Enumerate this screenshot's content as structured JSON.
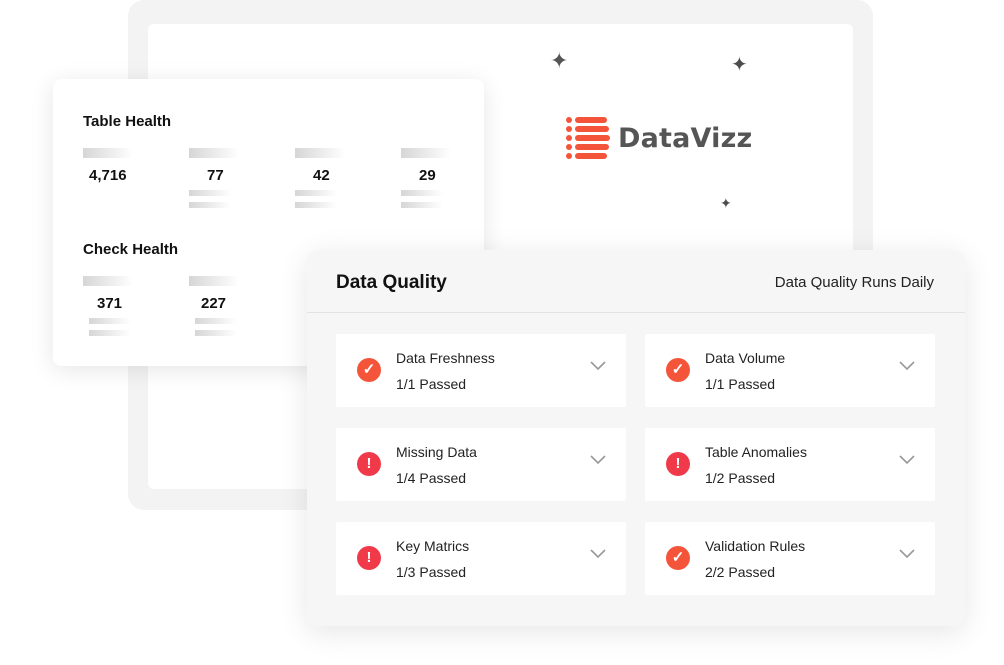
{
  "brand": {
    "name": "DataVizz",
    "color": "#f4553a",
    "text_color": "#555555"
  },
  "sparkles": [
    "sparkle-icon",
    "sparkle-icon",
    "sparkle-icon"
  ],
  "table_health": {
    "title": "Table Health",
    "values": [
      "4,716",
      "77",
      "42",
      "29"
    ]
  },
  "check_health": {
    "title": "Check Health",
    "values": [
      "371",
      "227"
    ]
  },
  "data_quality": {
    "title": "Data Quality",
    "subtitle": "Data Quality Runs Daily",
    "checks": [
      {
        "name": "Data Freshness",
        "status": "1/1 Passed",
        "state": "pass",
        "icon": "check-circle-icon"
      },
      {
        "name": "Data Volume",
        "status": "1/1 Passed",
        "state": "pass",
        "icon": "check-circle-icon"
      },
      {
        "name": "Missing Data",
        "status": "1/4 Passed",
        "state": "warn",
        "icon": "alert-circle-icon"
      },
      {
        "name": "Table Anomalies",
        "status": "1/2 Passed",
        "state": "warn",
        "icon": "alert-circle-icon"
      },
      {
        "name": "Key Matrics",
        "status": "1/3 Passed",
        "state": "warn",
        "icon": "alert-circle-icon"
      },
      {
        "name": "Validation Rules",
        "status": "2/2 Passed",
        "state": "pass",
        "icon": "check-circle-icon"
      }
    ],
    "colors": {
      "pass": "#f4553a",
      "warn": "#f03a4a"
    }
  }
}
